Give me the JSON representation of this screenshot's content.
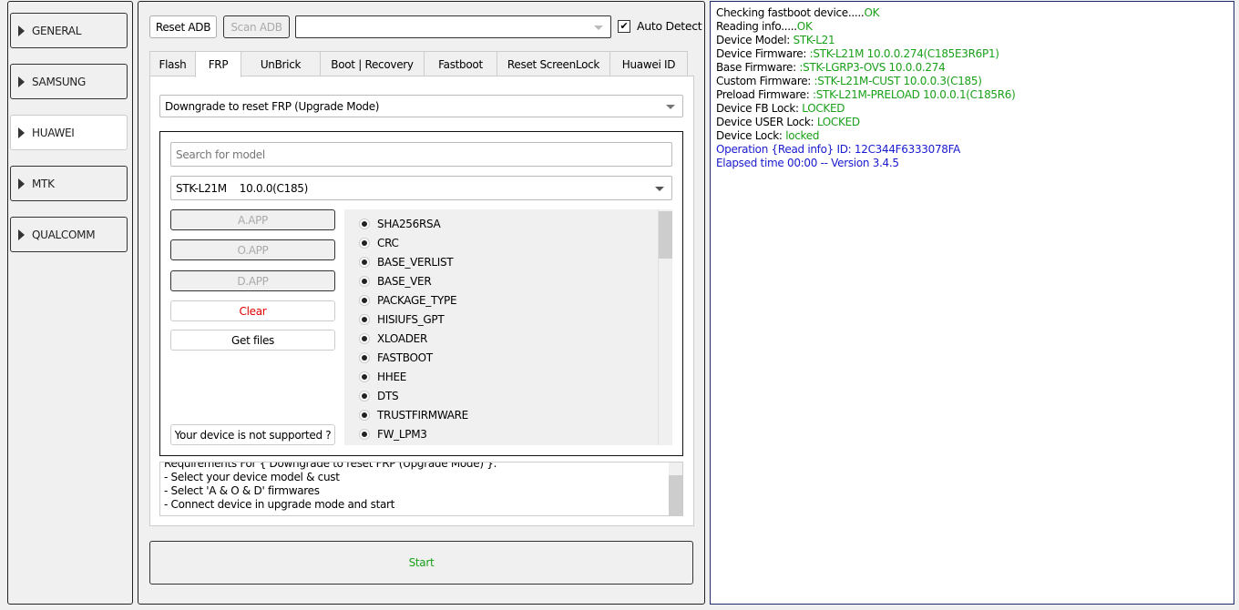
{
  "sidebar": {
    "items": [
      {
        "label": "GENERAL"
      },
      {
        "label": "SAMSUNG"
      },
      {
        "label": "HUAWEI",
        "active": true
      },
      {
        "label": "MTK"
      },
      {
        "label": "QUALCOMM"
      }
    ]
  },
  "toolbar": {
    "reset_adb": "Reset ADB",
    "scan_adb": "Scan ADB",
    "port_value": "",
    "auto_detect": "Auto Detect",
    "auto_detect_checked": true
  },
  "tabs": [
    "Flash",
    "FRP",
    "UnBrick",
    "Boot | Recovery",
    "Fastboot",
    "Reset ScreenLock",
    "Huawei ID"
  ],
  "active_tab": "FRP",
  "frp": {
    "method": "Downgrade to reset FRP (Upgrade Mode)",
    "search_placeholder": "Search for model",
    "model": "STK-L21M",
    "model_version": "10.0.0(C185)",
    "buttons": {
      "a_app": "A.APP",
      "o_app": "O.APP",
      "d_app": "D.APP",
      "clear": "Clear",
      "get_files": "Get files",
      "not_supported": "Your device is not supported ?"
    },
    "partitions": [
      "SHA256RSA",
      "CRC",
      "BASE_VERLIST",
      "BASE_VER",
      "PACKAGE_TYPE",
      "HISIUFS_GPT",
      "XLOADER",
      "FASTBOOT",
      "HHEE",
      "DTS",
      "TRUSTFIRMWARE",
      "FW_LPM3"
    ],
    "requirements": [
      "Requirements For { Downgrade to reset FRP (Upgrade Mode) }:",
      " - Select your device model & cust",
      " - Select 'A & O & D' firmwares",
      " - Connect device in upgrade mode and start"
    ],
    "start": "Start"
  },
  "log": [
    {
      "label": "Checking fastboot device.....",
      "value": "OK"
    },
    {
      "label": "Reading info.....",
      "value": "OK"
    },
    {
      "label": "Device Model: ",
      "value": "STK-L21"
    },
    {
      "label": "Device Firmware: ",
      "value": ":STK-L21M 10.0.0.274(C185E3R6P1)"
    },
    {
      "label": "Base Firmware: ",
      "value": ":STK-LGRP3-OVS 10.0.0.274"
    },
    {
      "label": "Custom Firmware: ",
      "value": ":STK-L21M-CUST 10.0.0.3(C185)"
    },
    {
      "label": "Preload Firmware: ",
      "value": ":STK-L21M-PRELOAD 10.0.0.1(C185R6)"
    },
    {
      "label": "Device FB Lock: ",
      "value": "LOCKED"
    },
    {
      "label": "Device USER Lock: ",
      "value": "LOCKED"
    },
    {
      "label": "Device Lock: ",
      "value": "locked"
    },
    {
      "label": "Operation {Read info} ID: 12C344F6333078FA",
      "value": ""
    },
    {
      "label": "Elapsed time 00:00 -- Version 3.4.5",
      "value": ""
    }
  ],
  "colors": {
    "ok": "#1aa01a",
    "info": "#1a1ad0",
    "clear": "#e00000"
  }
}
